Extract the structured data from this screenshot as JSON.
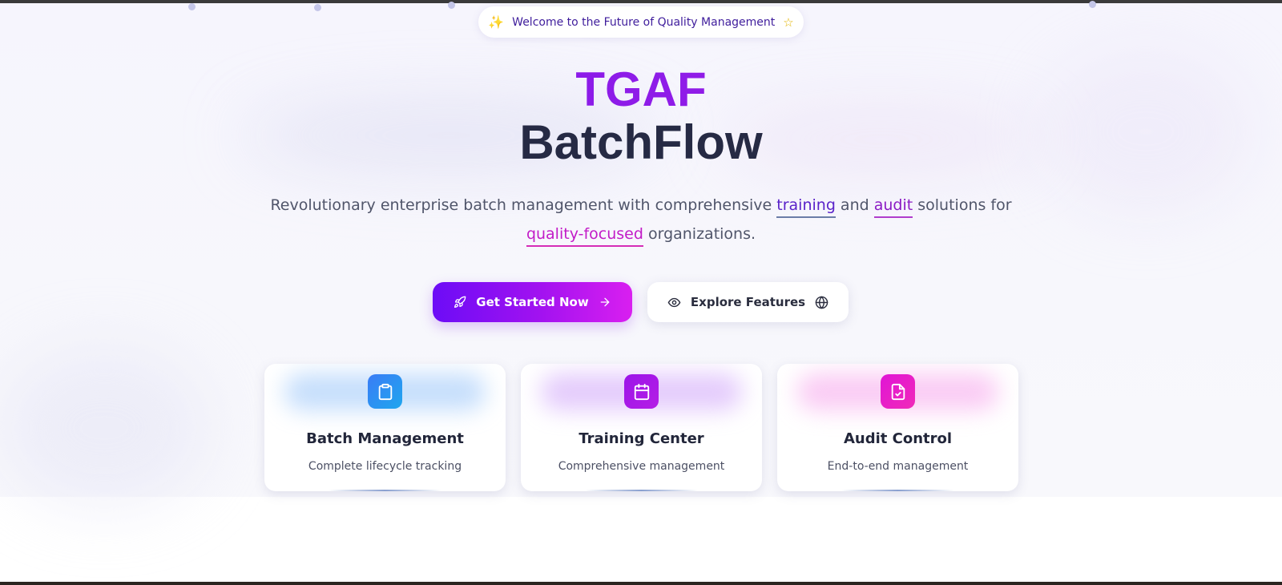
{
  "badge": {
    "text": "Welcome to the Future of Quality Management",
    "left_icon": "sparkle-icon",
    "right_icon": "star-icon"
  },
  "hero": {
    "title_line1": "TGAF",
    "title_line2": "BatchFlow",
    "subtitle": {
      "part1": "Revolutionary enterprise batch management with comprehensive ",
      "highlight1": "training",
      "part2": " and ",
      "highlight2": "audit",
      "part3": " solutions for",
      "highlight3": "quality-focused",
      "part4": " organizations."
    }
  },
  "actions": {
    "primary": {
      "label": "Get Started Now",
      "icon_left": "rocket-icon",
      "icon_right": "arrow-right-icon"
    },
    "secondary": {
      "label": "Explore Features",
      "icon_left": "eye-icon",
      "icon_right": "globe-icon"
    }
  },
  "features": [
    {
      "title": "Batch Management",
      "description": "Complete lifecycle tracking",
      "icon": "clipboard-icon",
      "color": "#2f8cf3"
    },
    {
      "title": "Training Center",
      "description": "Comprehensive management",
      "icon": "calendar-icon",
      "color": "#a417e6"
    },
    {
      "title": "Audit Control",
      "description": "End-to-end management",
      "icon": "file-check-icon",
      "color": "#e81ec8"
    }
  ],
  "colors": {
    "brand_purple": "#8a15ec",
    "title_dark": "#262a44",
    "button_gradient_start": "#6c0cf6",
    "button_gradient_end": "#d91ff0"
  }
}
